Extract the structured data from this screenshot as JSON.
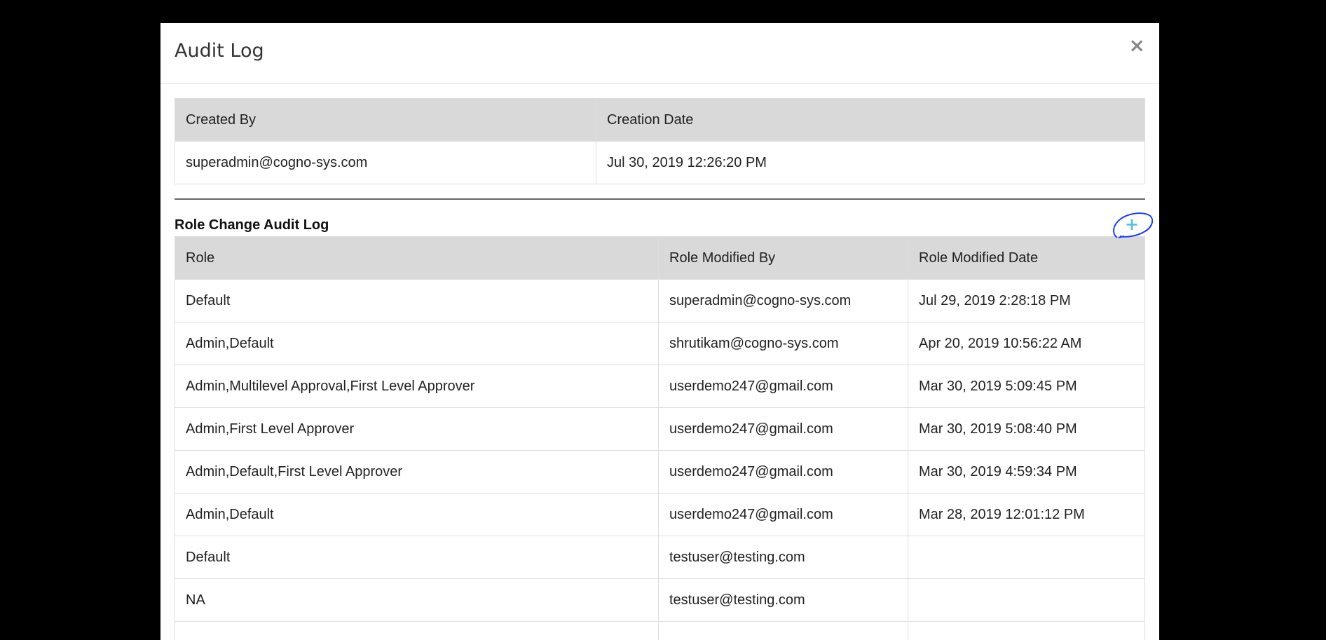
{
  "modal": {
    "title": "Audit Log",
    "close_label": "×"
  },
  "creation": {
    "headers": [
      "Created By",
      "Creation Date"
    ],
    "row": [
      "superadmin@cogno-sys.com",
      "Jul 30, 2019 12:26:20 PM"
    ]
  },
  "role_log": {
    "title": "Role Change Audit Log",
    "add_label": "+",
    "headers": [
      "Role",
      "Role Modified By",
      "Role Modified Date"
    ],
    "rows": [
      [
        "Default",
        "superadmin@cogno-sys.com",
        "Jul 29, 2019 2:28:18 PM"
      ],
      [
        "Admin,Default",
        "shrutikam@cogno-sys.com",
        "Apr 20, 2019 10:56:22 AM"
      ],
      [
        "Admin,Multilevel Approval,First Level Approver",
        "userdemo247@gmail.com",
        "Mar 30, 2019 5:09:45 PM"
      ],
      [
        "Admin,First Level Approver",
        "userdemo247@gmail.com",
        "Mar 30, 2019 5:08:40 PM"
      ],
      [
        "Admin,Default,First Level Approver",
        "userdemo247@gmail.com",
        "Mar 30, 2019 4:59:34 PM"
      ],
      [
        "Admin,Default",
        "userdemo247@gmail.com",
        "Mar 28, 2019 12:01:12 PM"
      ],
      [
        "Default",
        "testuser@testing.com",
        ""
      ],
      [
        "NA",
        "testuser@testing.com",
        ""
      ],
      [
        "",
        "",
        ""
      ]
    ]
  },
  "colors": {
    "header_bg": "#d9d9d9",
    "plus_icon": "#5bc0de",
    "annotation_circle": "#1a3cff"
  }
}
